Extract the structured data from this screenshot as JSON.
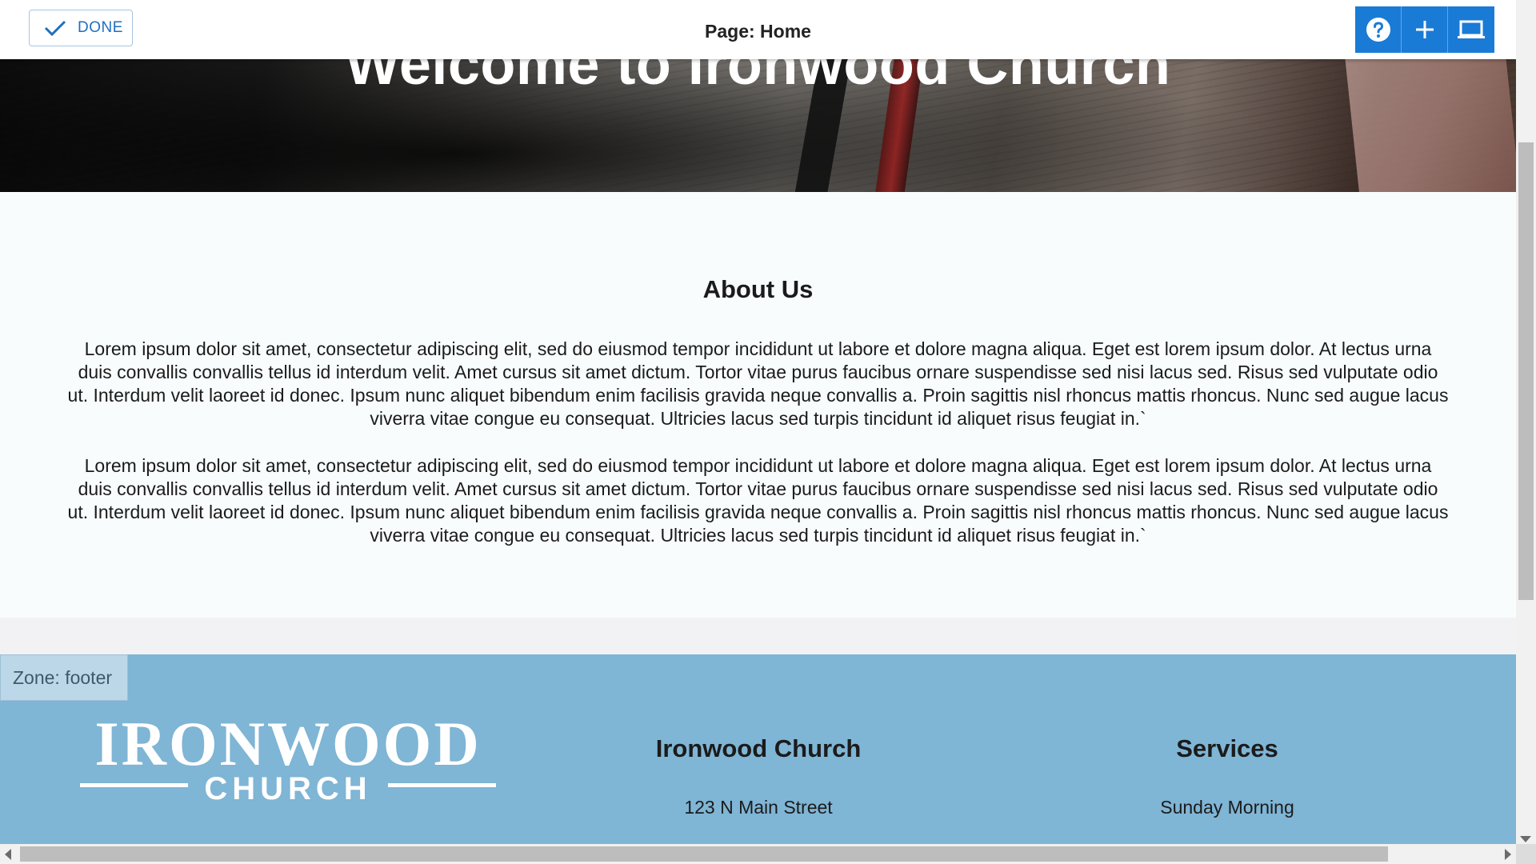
{
  "toolbar": {
    "done_label": "DONE",
    "page_label": "Page: Home",
    "tools": [
      {
        "icon": "help-icon"
      },
      {
        "icon": "plus-icon"
      },
      {
        "icon": "laptop-icon"
      }
    ],
    "accent_color": "#1a7bd6"
  },
  "hero": {
    "title": "Welcome to Ironwood Church"
  },
  "about": {
    "heading": "About Us",
    "paragraphs": [
      "Lorem ipsum dolor sit amet, consectetur adipiscing elit, sed do eiusmod tempor incididunt ut labore et dolore magna aliqua. Eget est lorem ipsum dolor. At lectus urna duis convallis convallis tellus id interdum velit. Amet cursus sit amet dictum. Tortor vitae purus faucibus ornare suspendisse sed nisi lacus sed. Risus sed vulputate odio ut. Interdum velit laoreet id donec. Ipsum nunc aliquet bibendum enim facilisis gravida neque convallis a. Proin sagittis nisl rhoncus mattis rhoncus. Nunc sed augue lacus viverra vitae congue eu consequat. Ultricies lacus sed turpis tincidunt id aliquet risus feugiat in.`",
      "Lorem ipsum dolor sit amet, consectetur adipiscing elit, sed do eiusmod tempor incididunt ut labore et dolore magna aliqua. Eget est lorem ipsum dolor. At lectus urna duis convallis convallis tellus id interdum velit. Amet cursus sit amet dictum. Tortor vitae purus faucibus ornare suspendisse sed nisi lacus sed. Risus sed vulputate odio ut. Interdum velit laoreet id donec. Ipsum nunc aliquet bibendum enim facilisis gravida neque convallis a. Proin sagittis nisl rhoncus mattis rhoncus. Nunc sed augue lacus viverra vitae congue eu consequat. Ultricies lacus sed turpis tincidunt id aliquet risus feugiat in.`"
    ]
  },
  "footer": {
    "zone_label": "Zone: footer",
    "logo": {
      "line1": "IRONWOOD",
      "line2": "CHURCH"
    },
    "church_heading": "Ironwood Church",
    "church_address": "123 N Main Street",
    "services_heading": "Services",
    "services_line": "Sunday Morning",
    "background_color": "#7fb5d5"
  }
}
